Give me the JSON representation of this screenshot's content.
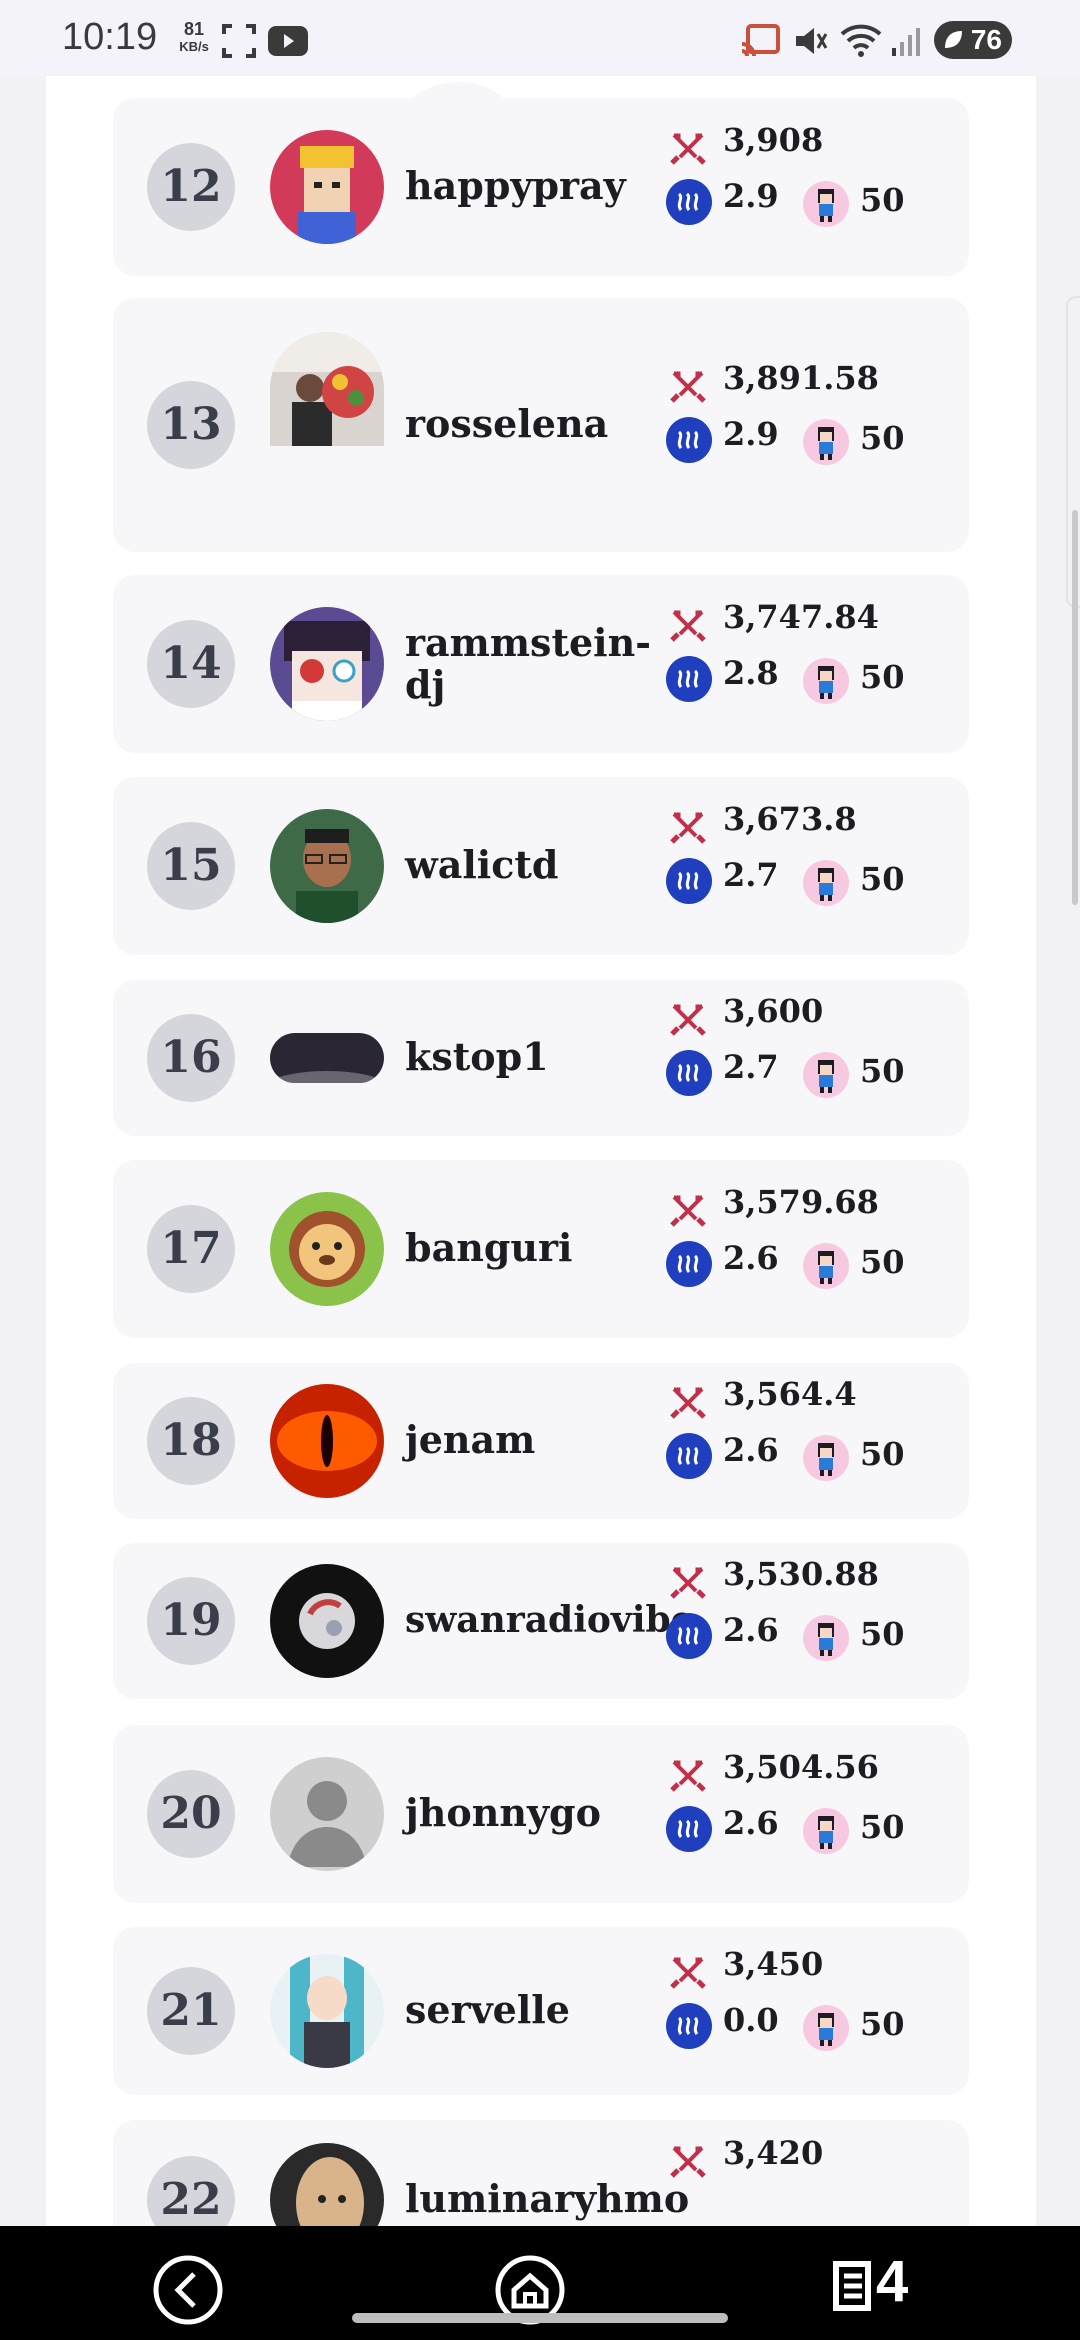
{
  "status_bar": {
    "time": "10:19",
    "speed_value": "81",
    "speed_unit": "KB/s",
    "battery": "76"
  },
  "leaderboard": [
    {
      "rank": "12",
      "user": "happypray",
      "power": "3,908",
      "steem": "2.9",
      "level": "50",
      "avatar_color": "#d23a5a"
    },
    {
      "rank": "13",
      "user": "rosselena",
      "power": "3,891.58",
      "steem": "2.9",
      "level": "50",
      "avatar_color": "#7a6a5e"
    },
    {
      "rank": "14",
      "user": "rammstein-dj",
      "power": "3,747.84",
      "steem": "2.8",
      "level": "50",
      "avatar_color": "#5b4b92"
    },
    {
      "rank": "15",
      "user": "walictd",
      "power": "3,673.8",
      "steem": "2.7",
      "level": "50",
      "avatar_color": "#3e6a48"
    },
    {
      "rank": "16",
      "user": "kstop1",
      "power": "3,600",
      "steem": "2.7",
      "level": "50",
      "avatar_color": "#4a4a5a"
    },
    {
      "rank": "17",
      "user": "banguri",
      "power": "3,579.68",
      "steem": "2.6",
      "level": "50",
      "avatar_color": "#8bc34a"
    },
    {
      "rank": "18",
      "user": "jenam",
      "power": "3,564.4",
      "steem": "2.6",
      "level": "50",
      "avatar_color": "#c62200"
    },
    {
      "rank": "19",
      "user": "swanradiovibe",
      "power": "3,530.88",
      "steem": "2.6",
      "level": "50",
      "avatar_color": "#111111"
    },
    {
      "rank": "20",
      "user": "jhonnygo",
      "power": "3,504.56",
      "steem": "2.6",
      "level": "50",
      "avatar_color": "#c8c8c8"
    },
    {
      "rank": "21",
      "user": "servelle",
      "power": "3,450",
      "steem": "0.0",
      "level": "50",
      "avatar_color": "#4db6c9"
    },
    {
      "rank": "22",
      "user": "luminaryhmo",
      "power": "3,420",
      "steem": "",
      "level": "",
      "avatar_color": "#d9b48a"
    }
  ],
  "colors": {
    "rank_badge": "#d4d6dc",
    "row_bg": "#f7f7fa",
    "steem_blue": "#1f3fbf",
    "sword_red": "#c0304a"
  },
  "nav": {
    "back_icon": "back-icon",
    "home_icon": "home-icon",
    "tabs_icon": "tabs-icon",
    "tab_count": "4"
  }
}
